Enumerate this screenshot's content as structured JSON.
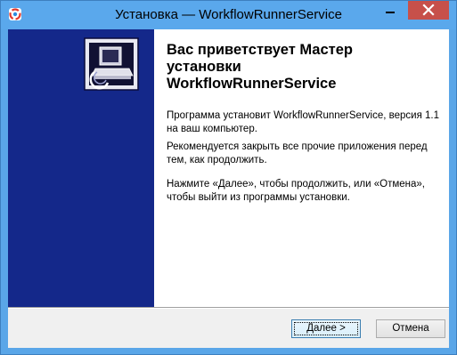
{
  "window": {
    "title": "Установка — WorkflowRunnerService",
    "controls": {
      "minimize": "minimize",
      "close": "close"
    }
  },
  "main": {
    "heading": "Вас приветствует Мастер\nустановки\nWorkflowRunnerService",
    "paragraph_install": "Программа установит WorkflowRunnerService, версия 1.1 на ваш компьютер.",
    "paragraph_close_apps": "Рекомендуется закрыть все прочие приложения перед тем, как продолжить.",
    "paragraph_next_cancel": "Нажмите «Далее», чтобы продолжить, или «Отмена», чтобы выйти из программы установки."
  },
  "footer": {
    "next_label": "Далее >",
    "cancel_label": "Отмена"
  },
  "colors": {
    "banner": "#14288a",
    "titlebar": "#5aa8ec",
    "close_button": "#c7504a"
  },
  "icons": {
    "app": "installer-app-icon",
    "banner": "setup-computer-icon"
  }
}
